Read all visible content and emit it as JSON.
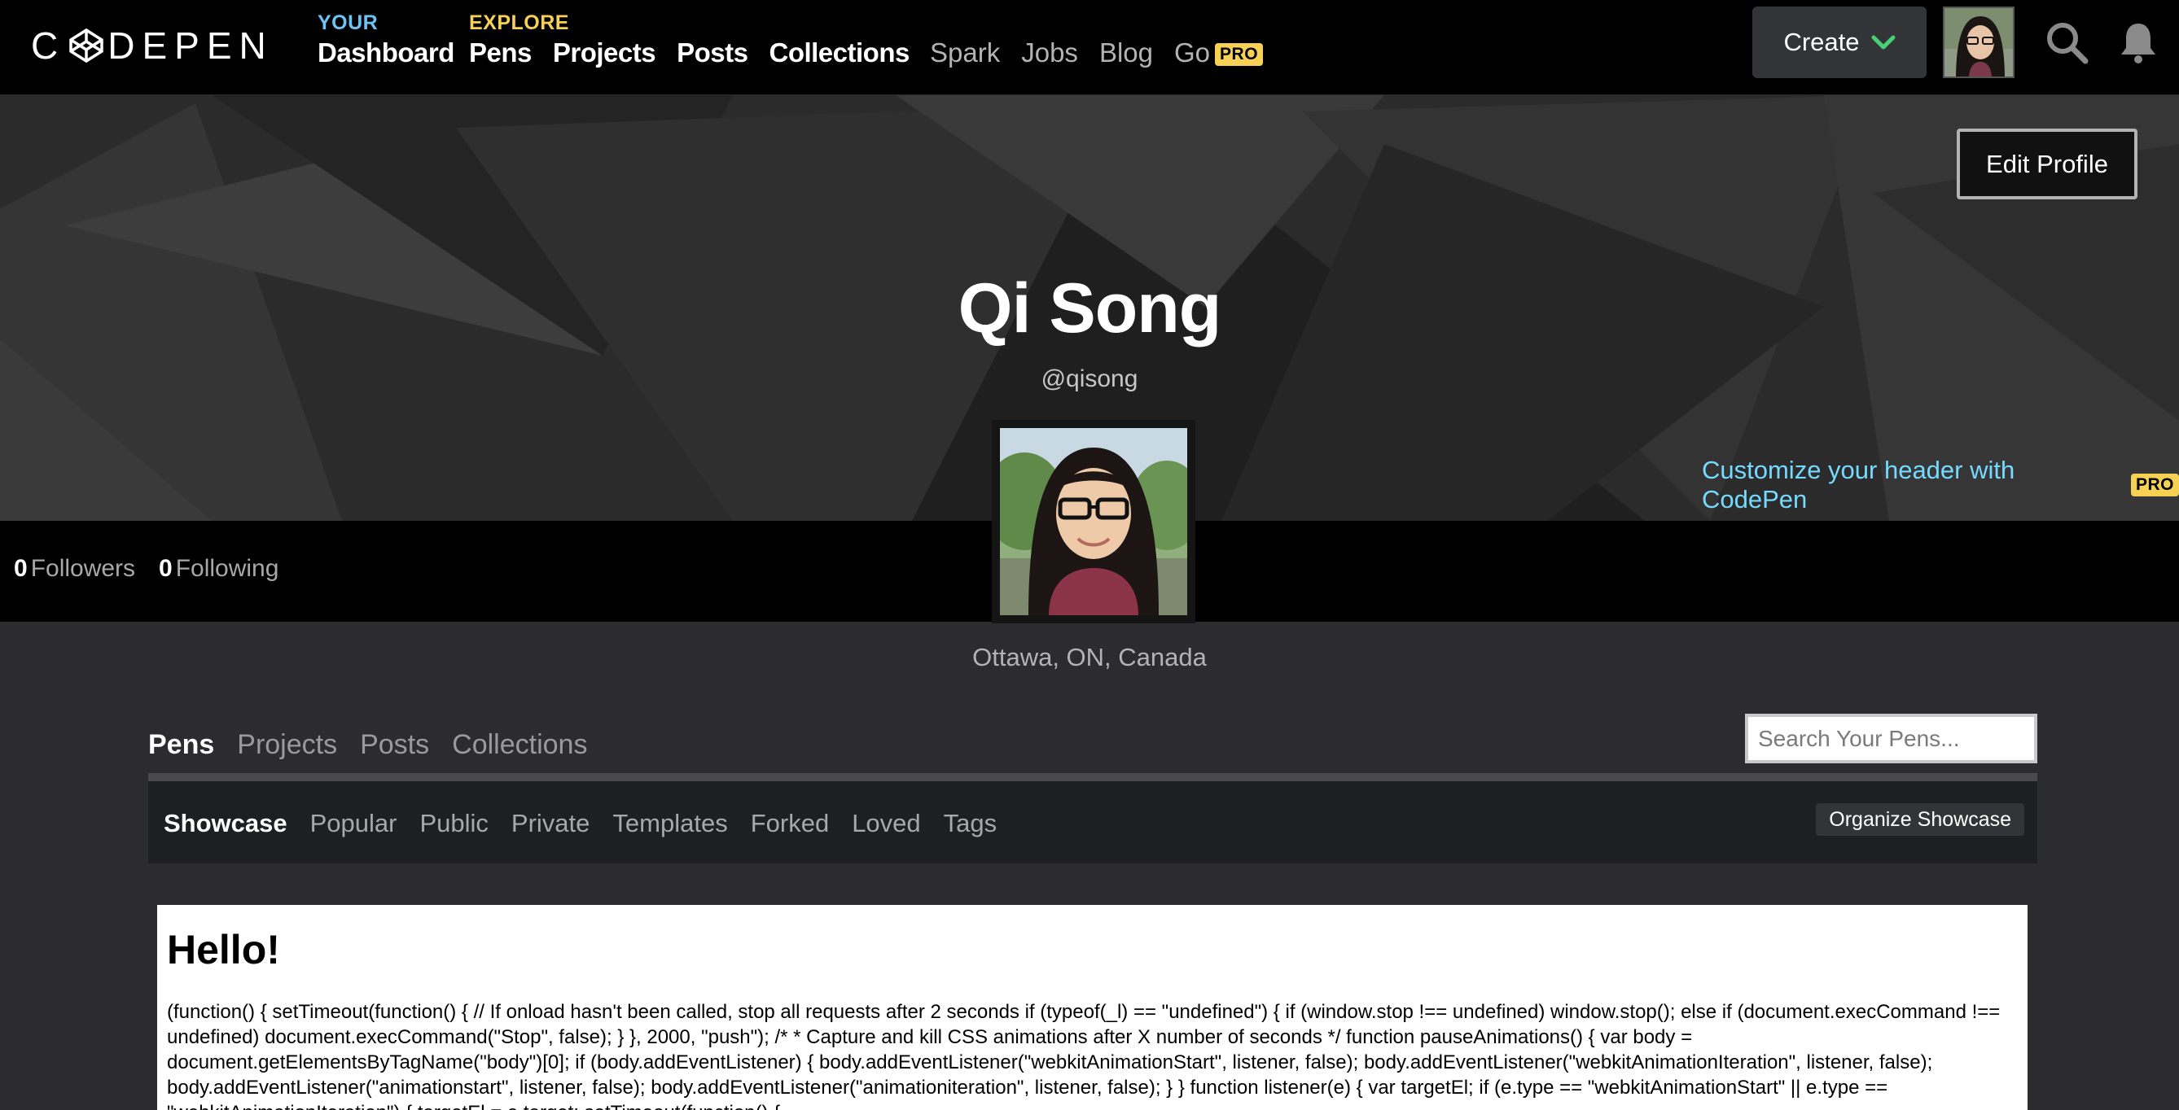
{
  "brand": {
    "logo_text": "CODEPEN"
  },
  "nav": {
    "your_kicker": "YOUR",
    "dashboard": "Dashboard",
    "explore_kicker": "EXPLORE",
    "pens": "Pens",
    "projects": "Projects",
    "posts": "Posts",
    "collections": "Collections",
    "spark": "Spark",
    "jobs": "Jobs",
    "blog": "Blog",
    "go": "Go",
    "pro_badge": "PRO",
    "create": "Create"
  },
  "profile": {
    "edit_profile": "Edit Profile",
    "name": "Qi Song",
    "handle": "@qisong",
    "customize": "Customize your header with CodePen",
    "customize_badge": "PRO",
    "followers_count": "0",
    "followers_label": "Followers",
    "following_count": "0",
    "following_label": "Following",
    "location": "Ottawa, ON, Canada"
  },
  "tabs": {
    "main": [
      "Pens",
      "Projects",
      "Posts",
      "Collections"
    ],
    "active_main": "Pens",
    "search_placeholder": "Search Your Pens...",
    "sub": [
      "Showcase",
      "Popular",
      "Public",
      "Private",
      "Templates",
      "Forked",
      "Loved",
      "Tags"
    ],
    "active_sub": "Showcase",
    "organize": "Organize Showcase"
  },
  "pen_preview": {
    "heading": "Hello!",
    "code": "(function() { setTimeout(function() { // If onload hasn't been called, stop all requests after 2 seconds if (typeof(_l) == \"undefined\") { if (window.stop !== undefined) window.stop(); else if (document.execCommand !== undefined) document.execCommand(\"Stop\", false); } }, 2000, \"push\"); /* * Capture and kill CSS animations after X number of seconds */ function pauseAnimations() { var body = document.getElementsByTagName(\"body\")[0]; if (body.addEventListener) { body.addEventListener(\"webkitAnimationStart\", listener, false); body.addEventListener(\"webkitAnimationIteration\", listener, false); body.addEventListener(\"animationstart\", listener, false); body.addEventListener(\"animationiteration\", listener, false); } } function listener(e) { var targetEl; if (e.type == \"webkitAnimationStart\" || e.type == \"webkitAnimationIteration\") { targetEl = e.target; setTimeout(function() {"
  },
  "colors": {
    "accent_your": "#6fc2f6",
    "accent_explore": "#f7d154",
    "pro_yellow": "#f7d154",
    "customize_link": "#76daff",
    "create_chevron": "#47cf73"
  },
  "icons": [
    "codepen-logo-icon",
    "chevron-down-icon",
    "search-icon",
    "bell-icon"
  ]
}
